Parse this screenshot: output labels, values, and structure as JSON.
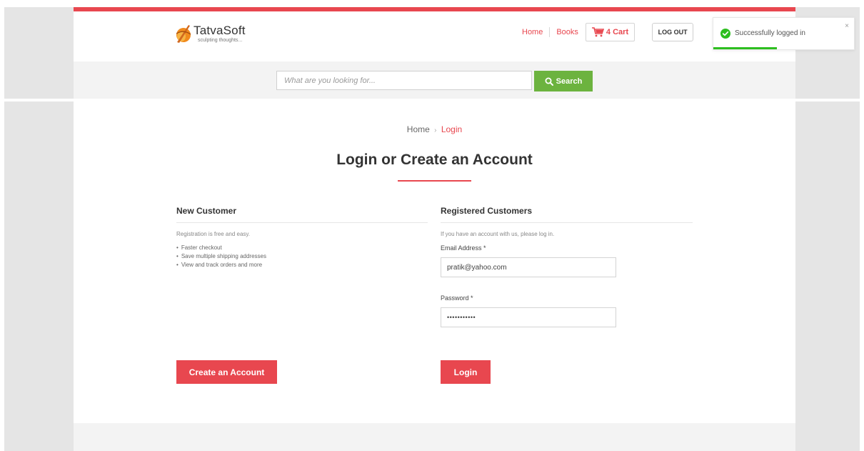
{
  "brand": {
    "name": "TatvaSoft",
    "tagline": "sculpting thoughts..."
  },
  "nav": {
    "home": "Home",
    "books": "Books",
    "cart": "4 Cart",
    "logout": "LOG OUT"
  },
  "search": {
    "placeholder": "What are you looking for...",
    "button": "Search"
  },
  "breadcrumb": {
    "home": "Home",
    "current": "Login"
  },
  "page_title": "Login or Create an Account",
  "new_customer": {
    "heading": "New Customer",
    "intro": "Registration is free and easy.",
    "benefits": [
      "Faster checkout",
      "Save multiple shipping addresses",
      "View and track orders and more"
    ],
    "create_button": "Create an Account"
  },
  "registered": {
    "heading": "Registered Customers",
    "intro": "If you have an account with us, please log in.",
    "email_label": "Email Address *",
    "email_value": "pratik@yahoo.com",
    "password_label": "Password *",
    "password_value": "•••••••••••",
    "login_button": "Login"
  },
  "toast": {
    "message": "Successfully logged in",
    "close": "×",
    "progress_fraction": 0.45
  },
  "colors": {
    "accent": "#e8474f",
    "search_button": "#6cb33f",
    "success": "#2dbe1f"
  }
}
